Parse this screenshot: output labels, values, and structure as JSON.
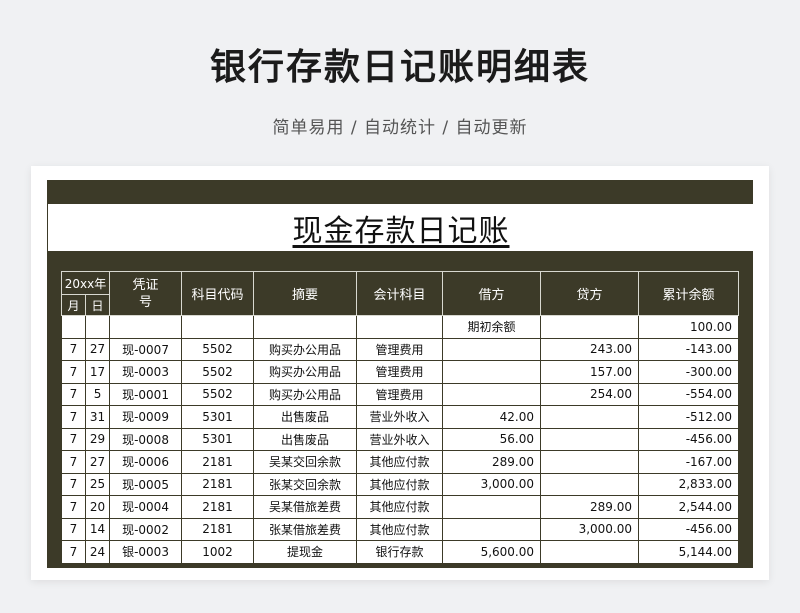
{
  "page": {
    "title": "银行存款日记账明细表",
    "subtitle": "简单易用 / 自动统计 / 自动更新"
  },
  "sheet": {
    "banner": "现金存款日记账",
    "headers": {
      "year": "20xx年",
      "month": "月",
      "day": "日",
      "voucher": "凭证\n号",
      "code": "科目代码",
      "summary": "摘要",
      "account": "会计科目",
      "debit": "借方",
      "credit": "贷方",
      "balance": "累计余额"
    },
    "opening": {
      "label": "期初余额",
      "balance": "100.00"
    },
    "rows": [
      {
        "m": "7",
        "d": "27",
        "v": "现-0007",
        "code": "5502",
        "summary": "购买办公用品",
        "account": "管理费用",
        "debit": "",
        "credit": "243.00",
        "balance": "-143.00"
      },
      {
        "m": "7",
        "d": "17",
        "v": "现-0003",
        "code": "5502",
        "summary": "购买办公用品",
        "account": "管理费用",
        "debit": "",
        "credit": "157.00",
        "balance": "-300.00"
      },
      {
        "m": "7",
        "d": "5",
        "v": "现-0001",
        "code": "5502",
        "summary": "购买办公用品",
        "account": "管理费用",
        "debit": "",
        "credit": "254.00",
        "balance": "-554.00"
      },
      {
        "m": "7",
        "d": "31",
        "v": "现-0009",
        "code": "5301",
        "summary": "出售废品",
        "account": "营业外收入",
        "debit": "42.00",
        "credit": "",
        "balance": "-512.00"
      },
      {
        "m": "7",
        "d": "29",
        "v": "现-0008",
        "code": "5301",
        "summary": "出售废品",
        "account": "营业外收入",
        "debit": "56.00",
        "credit": "",
        "balance": "-456.00"
      },
      {
        "m": "7",
        "d": "27",
        "v": "现-0006",
        "code": "2181",
        "summary": "吴某交回余款",
        "account": "其他应付款",
        "debit": "289.00",
        "credit": "",
        "balance": "-167.00"
      },
      {
        "m": "7",
        "d": "25",
        "v": "现-0005",
        "code": "2181",
        "summary": "张某交回余款",
        "account": "其他应付款",
        "debit": "3,000.00",
        "credit": "",
        "balance": "2,833.00"
      },
      {
        "m": "7",
        "d": "20",
        "v": "现-0004",
        "code": "2181",
        "summary": "吴某借旅差费",
        "account": "其他应付款",
        "debit": "",
        "credit": "289.00",
        "balance": "2,544.00"
      },
      {
        "m": "7",
        "d": "14",
        "v": "现-0002",
        "code": "2181",
        "summary": "张某借旅差费",
        "account": "其他应付款",
        "debit": "",
        "credit": "3,000.00",
        "balance": "-456.00"
      },
      {
        "m": "7",
        "d": "24",
        "v": "银-0003",
        "code": "1002",
        "summary": "提现金",
        "account": "银行存款",
        "debit": "5,600.00",
        "credit": "",
        "balance": "5,144.00"
      }
    ]
  }
}
